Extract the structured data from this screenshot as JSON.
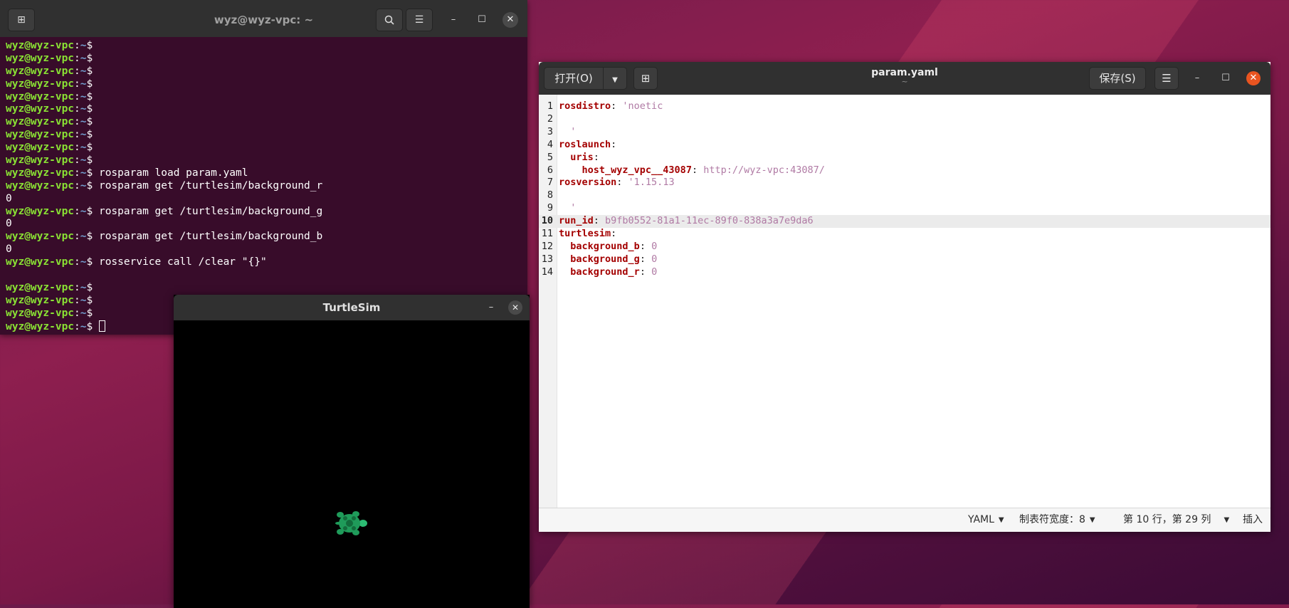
{
  "terminal": {
    "title": "wyz@wyz-vpc: ~",
    "prompt_user": "wyz@wyz-vpc",
    "prompt_colon": ":",
    "prompt_path": "~",
    "prompt_symbol": "$ ",
    "lines": [
      {
        "prompt": true,
        "text": ""
      },
      {
        "prompt": true,
        "text": ""
      },
      {
        "prompt": true,
        "text": ""
      },
      {
        "prompt": true,
        "text": ""
      },
      {
        "prompt": true,
        "text": ""
      },
      {
        "prompt": true,
        "text": ""
      },
      {
        "prompt": true,
        "text": ""
      },
      {
        "prompt": true,
        "text": ""
      },
      {
        "prompt": true,
        "text": ""
      },
      {
        "prompt": true,
        "text": ""
      },
      {
        "prompt": true,
        "text": "rosparam load param.yaml"
      },
      {
        "prompt": true,
        "text": "rosparam get /turtlesim/background_r"
      },
      {
        "prompt": false,
        "text": "0"
      },
      {
        "prompt": true,
        "text": "rosparam get /turtlesim/background_g"
      },
      {
        "prompt": false,
        "text": "0"
      },
      {
        "prompt": true,
        "text": "rosparam get /turtlesim/background_b"
      },
      {
        "prompt": false,
        "text": "0"
      },
      {
        "prompt": true,
        "text": "rosservice call /clear \"{}\""
      },
      {
        "prompt": false,
        "text": ""
      },
      {
        "prompt": true,
        "text": ""
      },
      {
        "prompt": true,
        "text": ""
      },
      {
        "prompt": true,
        "text": ""
      },
      {
        "prompt": true,
        "text": "",
        "cursor": true
      }
    ]
  },
  "turtlesim": {
    "title": "TurtleSim",
    "background_color": "#000000",
    "turtle_color": "#1f9b5a"
  },
  "gedit": {
    "open_label": "打开(O)",
    "save_label": "保存(S)",
    "title": "param.yaml",
    "subtitle": "~",
    "current_line": 10,
    "lines": [
      {
        "n": "1",
        "key": "rosdistro",
        "sep": ": ",
        "val": "'noetic",
        "indent": ""
      },
      {
        "n": "2",
        "key": "",
        "sep": "",
        "val": "",
        "indent": ""
      },
      {
        "n": "3",
        "key": "",
        "sep": "",
        "val": "'",
        "indent": "  "
      },
      {
        "n": "4",
        "key": "roslaunch",
        "sep": ":",
        "val": "",
        "indent": ""
      },
      {
        "n": "5",
        "key": "uris",
        "sep": ":",
        "val": "",
        "indent": "  "
      },
      {
        "n": "6",
        "key": "host_wyz_vpc__43087",
        "sep": ": ",
        "val": "http://wyz-vpc:43087/",
        "indent": "    "
      },
      {
        "n": "7",
        "key": "rosversion",
        "sep": ": ",
        "val": "'1.15.13",
        "indent": ""
      },
      {
        "n": "8",
        "key": "",
        "sep": "",
        "val": "",
        "indent": ""
      },
      {
        "n": "9",
        "key": "",
        "sep": "",
        "val": "'",
        "indent": "  "
      },
      {
        "n": "10",
        "key": "run_id",
        "sep": ": ",
        "val": "b9fb0552-81a1-11ec-89f0-838a3a7e9da6",
        "indent": ""
      },
      {
        "n": "11",
        "key": "turtlesim",
        "sep": ":",
        "val": "",
        "indent": ""
      },
      {
        "n": "12",
        "key": "background_b",
        "sep": ": ",
        "val": "0",
        "indent": "  "
      },
      {
        "n": "13",
        "key": "background_g",
        "sep": ": ",
        "val": "0",
        "indent": "  "
      },
      {
        "n": "14",
        "key": "background_r",
        "sep": ": ",
        "val": "0",
        "indent": "  "
      }
    ],
    "status": {
      "language": "YAML",
      "tab_width": "制表符宽度：8",
      "position": "第 10 行，第 29 列",
      "mode": "插入"
    }
  },
  "colors": {
    "terminal_bg": "#380c2a",
    "prompt_user": "#8ae234",
    "prompt_path": "#729fcf",
    "close_accent": "#e95420",
    "yaml_key": "#a40000",
    "yaml_value": "#b07aa4"
  },
  "icons": [
    "new-tab-icon",
    "search-icon",
    "hamburger-menu-icon",
    "minimize-icon",
    "maximize-icon",
    "close-icon",
    "dropdown-arrow-icon",
    "new-document-icon",
    "turtle-icon"
  ]
}
